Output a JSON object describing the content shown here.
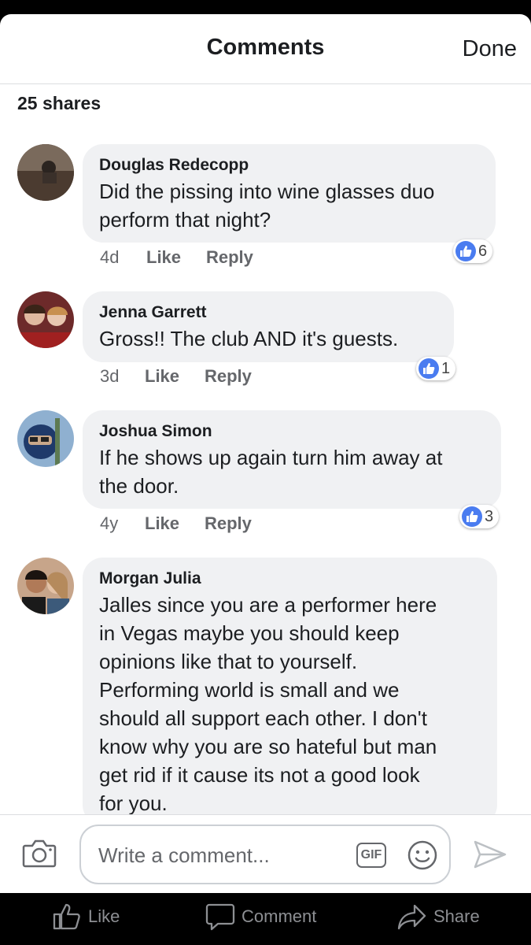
{
  "header": {
    "title": "Comments",
    "done": "Done"
  },
  "shares": "25 shares",
  "comments": [
    {
      "author": "Douglas Redecopp",
      "lines": [
        "Did the pissing into wine glasses duo",
        "perform that night?"
      ],
      "time": "4d",
      "like": "Like",
      "reply": "Reply",
      "reactions": "6"
    },
    {
      "author": "Jenna Garrett",
      "lines": [
        "Gross!! The club AND it's guests."
      ],
      "time": "3d",
      "like": "Like",
      "reply": "Reply",
      "reactions": "1"
    },
    {
      "author": "Joshua Simon",
      "lines": [
        "If he shows up again turn him away at",
        "the door."
      ],
      "time": "4y",
      "like": "Like",
      "reply": "Reply",
      "reactions": "3"
    },
    {
      "author": "Morgan Julia",
      "lines": [
        "Jalles since you are a performer here",
        "in Vegas maybe you should keep",
        "opinions like that to yourself.",
        "Performing world is small and we",
        "should all support each other. I don't",
        "know why you are so hateful but man",
        "get rid if it cause its not a good look",
        "for you."
      ]
    }
  ],
  "composer": {
    "placeholder": "Write a comment...",
    "gif": "GIF"
  },
  "tabbar": {
    "like": "Like",
    "comment": "Comment",
    "share": "Share"
  },
  "colors": {
    "accent": "#4a7cf0",
    "bubble": "#f0f1f3",
    "muted": "#65676b"
  },
  "icons": [
    "camera-icon",
    "gif-icon",
    "emoji-icon",
    "send-icon",
    "thumbs-up-icon",
    "speech-bubble-icon",
    "share-arrow-icon"
  ]
}
